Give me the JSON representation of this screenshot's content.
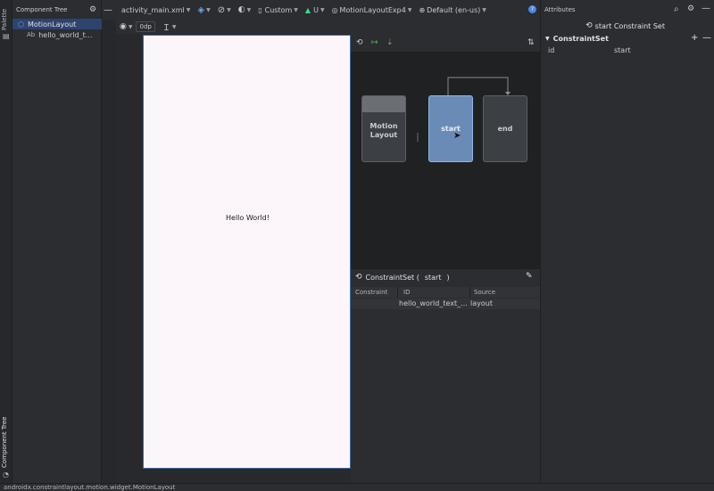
{
  "palette_label": "Palette",
  "component_tree_vlabel": "Component Tree",
  "component_tree": {
    "title": "Component Tree",
    "items": [
      {
        "icon": "motion-layout-icon",
        "label": "MotionLayout"
      },
      {
        "icon": "Ab",
        "label": "hello_world_t..."
      }
    ]
  },
  "toolbar": {
    "file": "activity_main.xml",
    "device": "Custom",
    "api": "U",
    "theme": "MotionLayoutExp4",
    "locale": "Default (en-us)"
  },
  "toolbar2": {
    "margin": "0dp"
  },
  "canvas": {
    "hello_text": "Hello World!"
  },
  "motion": {
    "nodes": {
      "layout": "Motion\nLayout",
      "start": "start",
      "end": "end"
    }
  },
  "constraint_set_panel": {
    "title_prefix": "ConstraintSet (",
    "title_name": "start",
    "title_suffix": ")",
    "columns": [
      "Constraint",
      "ID",
      "Source"
    ],
    "rows": [
      {
        "constraint": "",
        "id": "hello_world_text_...",
        "source": "layout"
      }
    ]
  },
  "attributes": {
    "title": "Attributes",
    "subtitle": "start Constraint Set",
    "section": "ConstraintSet",
    "rows": [
      {
        "key": "id",
        "value": "start"
      }
    ]
  },
  "status_bar": "androidx.constraintlayout.motion.widget.MotionLayout"
}
